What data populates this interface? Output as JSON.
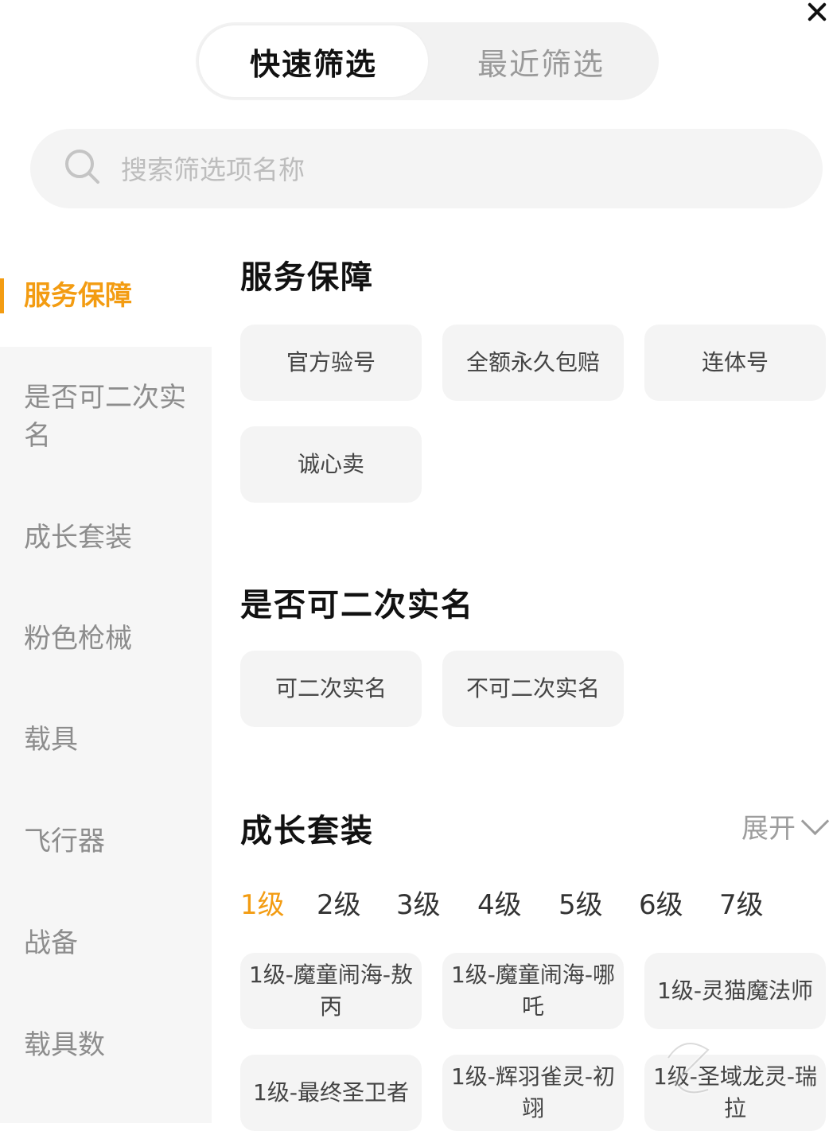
{
  "tabs": {
    "quick": "快速筛选",
    "recent": "最近筛选"
  },
  "search": {
    "placeholder": "搜索筛选项名称"
  },
  "sidebar": {
    "items": [
      {
        "label": "服务保障"
      },
      {
        "label": "是否可二次实名"
      },
      {
        "label": "成长套装"
      },
      {
        "label": "粉色枪械"
      },
      {
        "label": "载具"
      },
      {
        "label": "飞行器"
      },
      {
        "label": "战备"
      },
      {
        "label": "载具数"
      }
    ],
    "active_color": "#f39c12"
  },
  "sections": {
    "service": {
      "title": "服务保障",
      "options": [
        "官方验号",
        "全额永久包赔",
        "连体号",
        "诚心卖"
      ]
    },
    "realname": {
      "title": "是否可二次实名",
      "options": [
        "可二次实名",
        "不可二次实名"
      ]
    },
    "growth": {
      "title": "成长套装",
      "expand_label": "展开",
      "levels": [
        "1级",
        "2级",
        "3级",
        "4级",
        "5级",
        "6级",
        "7级"
      ],
      "active_level": "1级",
      "options": [
        "1级-魔童闹海-敖丙",
        "1级-魔童闹海-哪吒",
        "1级-灵猫魔法师",
        "1级-最终圣卫者",
        "1级-辉羽雀灵-初翊",
        "1级-圣域龙灵-瑞拉"
      ]
    }
  },
  "watermark": {
    "text": "九游"
  }
}
